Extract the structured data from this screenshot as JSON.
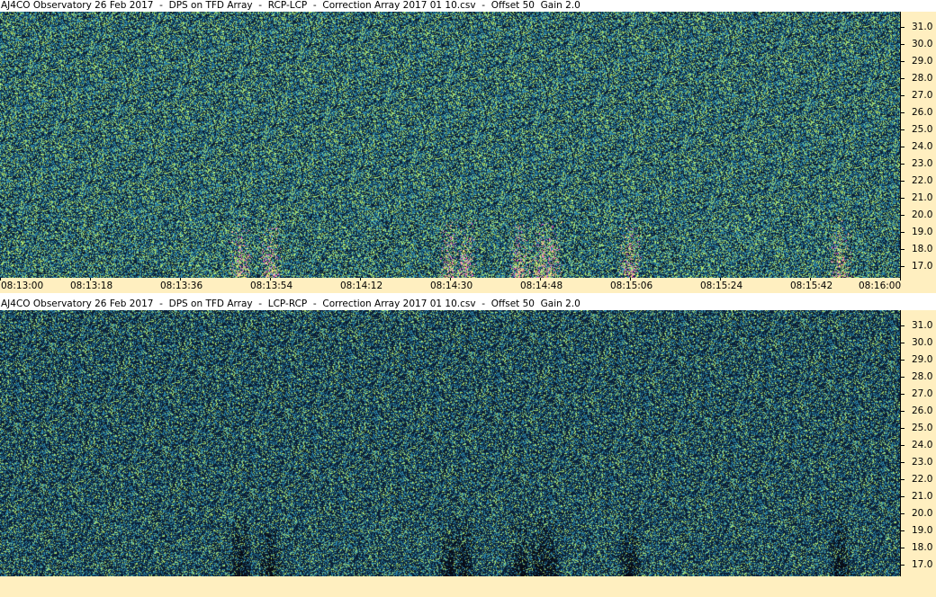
{
  "window": {
    "colors": {
      "axis_bg": "#ffefc0",
      "noise_low": "#0b1f35",
      "noise_mid": "#2a7fa0",
      "noise_high": "#a8e070",
      "burst": "#ff66cc"
    }
  },
  "chart_data": [
    {
      "type": "heatmap",
      "title": "AJ4CO Observatory 26 Feb 2017  -  DPS on TFD Array  -  RCP-LCP  -  Correction Array 2017 01 10.csv  -  Offset 50  Gain 2.0",
      "ylabel": "",
      "y_ticks": [
        "31.0",
        "30.0",
        "29.0",
        "28.0",
        "27.0",
        "26.0",
        "25.0",
        "24.0",
        "23.0",
        "22.0",
        "21.0",
        "20.0",
        "19.0",
        "18.0",
        "17.0"
      ],
      "ylim": [
        16.3,
        31.7
      ],
      "x_ticks": [
        "08:13:00",
        "08:13:18",
        "08:13:36",
        "08:13:54",
        "08:14:12",
        "08:14:30",
        "08:14:48",
        "08:15:06",
        "08:15:24",
        "08:15:42",
        "08:16:00"
      ],
      "xlim": [
        "08:13:00",
        "08:16:00"
      ],
      "polarity": "positive",
      "burst_times": [
        "08:13:48",
        "08:13:54",
        "08:14:30",
        "08:14:33",
        "08:14:44",
        "08:14:48",
        "08:14:50",
        "08:15:06",
        "08:15:48"
      ]
    },
    {
      "type": "heatmap",
      "title": "AJ4CO Observatory 26 Feb 2017  -  DPS on TFD Array  -  LCP-RCP  -  Correction Array 2017 01 10.csv  -  Offset 50  Gain 2.0",
      "ylabel": "",
      "y_ticks": [
        "31.0",
        "30.0",
        "29.0",
        "28.0",
        "27.0",
        "26.0",
        "25.0",
        "24.0",
        "23.0",
        "22.0",
        "21.0",
        "20.0",
        "19.0",
        "18.0",
        "17.0"
      ],
      "ylim": [
        16.3,
        31.7
      ],
      "polarity": "negative",
      "burst_times": [
        "08:13:48",
        "08:13:54",
        "08:14:30",
        "08:14:33",
        "08:14:44",
        "08:14:48",
        "08:14:50",
        "08:15:06",
        "08:15:48"
      ]
    }
  ]
}
